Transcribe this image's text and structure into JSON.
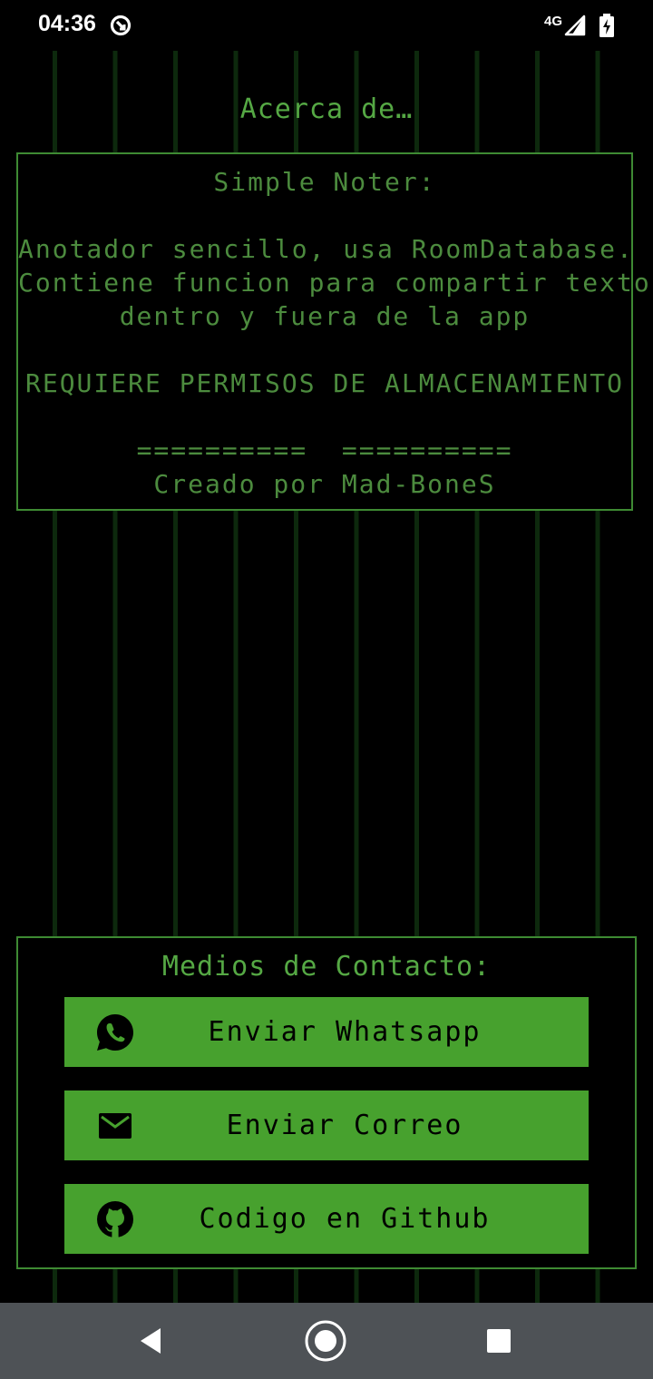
{
  "status_bar": {
    "time": "04:36",
    "network": "4G",
    "icons": [
      "sync-icon",
      "signal-icon",
      "battery-charging-icon"
    ]
  },
  "about": {
    "title": "Acerca de…"
  },
  "info": {
    "app_name": "Simple Noter:",
    "description_line1": "Anotador sencillo, usa RoomDatabase.",
    "description_line2": "Contiene funcion para compartir texto",
    "description_line3": "dentro y fuera de la app",
    "permissions": "REQUIERE PERMISOS DE ALMACENAMIENTO",
    "separator": "==========  ==========",
    "credits": "Creado por Mad-BoneS"
  },
  "contact": {
    "title": "Medios de Contacto:",
    "buttons": [
      {
        "label": "Enviar Whatsapp",
        "icon": "whatsapp-icon"
      },
      {
        "label": "Enviar Correo",
        "icon": "mail-icon"
      },
      {
        "label": "Codigo en Github",
        "icon": "github-icon"
      }
    ]
  },
  "nav": {
    "icons": [
      "back-icon",
      "home-icon",
      "recents-icon"
    ]
  },
  "colors": {
    "background": "#000000",
    "grid": "#0d290d",
    "text_green": "#4c8b3e",
    "border_green": "#3e8a33",
    "button_green": "#47a12e",
    "nav_bar": "#4e5256"
  }
}
